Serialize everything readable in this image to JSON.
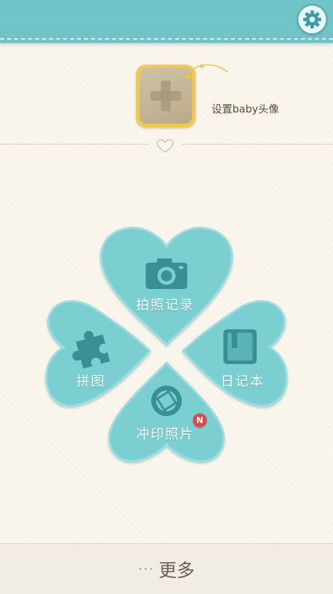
{
  "header": {
    "settings_icon": "gear-icon",
    "bg_color": "#6dc3c6"
  },
  "avatar": {
    "label": "设置baby头像",
    "icon": "plus-icon",
    "frame_color": "#f2c94c"
  },
  "menu": {
    "petal_color": "#7ccfd1",
    "items": [
      {
        "label": "拍照记录",
        "icon": "camera-icon"
      },
      {
        "label": "拼图",
        "icon": "puzzle-icon"
      },
      {
        "label": "日记本",
        "icon": "book-icon"
      },
      {
        "label": "冲印照片",
        "icon": "aperture-icon",
        "badge": "N"
      }
    ]
  },
  "footer": {
    "dots": "···",
    "label": "更多"
  }
}
